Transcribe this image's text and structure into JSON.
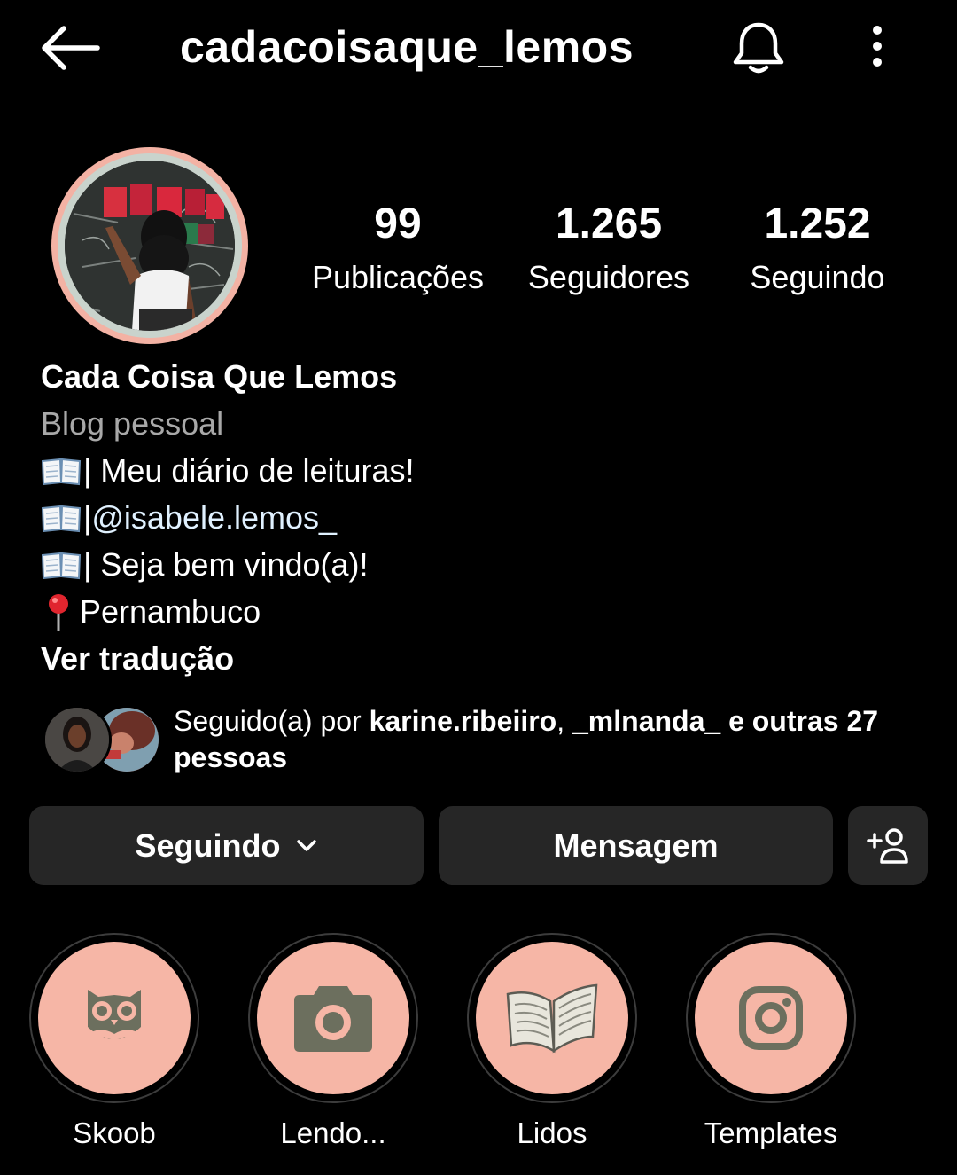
{
  "header": {
    "username": "cadacoisaque_lemos",
    "back_icon": "arrow-left-icon",
    "notifications_icon": "bell-icon",
    "more_icon": "more-vertical-icon"
  },
  "stats": {
    "posts": {
      "value": "99",
      "label": "Publicações"
    },
    "followers": {
      "value": "1.265",
      "label": "Seguidores"
    },
    "following": {
      "value": "1.252",
      "label": "Seguindo"
    }
  },
  "bio": {
    "name": "Cada Coisa Que Lemos",
    "category": "Blog pessoal",
    "line1": "| Meu diário de leituras!",
    "line2_prefix": "|",
    "line2_mention": "@isabele.lemos_",
    "line3": "| Seja bem vindo(a)!",
    "line4": "Pernambuco",
    "see_translation": "Ver tradução"
  },
  "followed_by": {
    "prefix": "Seguido(a) por ",
    "user1": "karine.ribeiiro",
    "separator": ", ",
    "user2": "_mlnanda_",
    "suffix": " e outras 27 pessoas"
  },
  "actions": {
    "following_label": "Seguindo",
    "message_label": "Mensagem",
    "add_person_icon": "add-person-icon"
  },
  "highlights": [
    {
      "label": "Skoob",
      "icon": "owl-icon"
    },
    {
      "label": "Lendo...",
      "icon": "camera-icon"
    },
    {
      "label": "Lidos",
      "icon": "open-book-icon"
    },
    {
      "label": "Templates",
      "icon": "instagram-icon"
    }
  ],
  "colors": {
    "background": "#000000",
    "button": "#262626",
    "highlight_fill": "#f6b6a6",
    "highlight_icon": "#6c6f5e",
    "secondary_text": "#a8a8a8"
  }
}
